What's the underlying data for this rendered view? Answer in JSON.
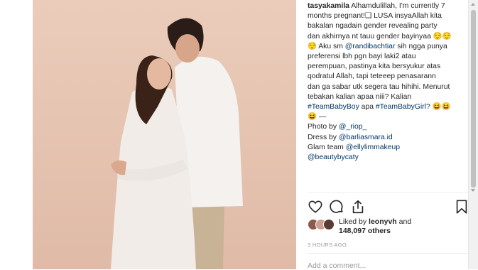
{
  "post": {
    "username": "tasyakamila",
    "caption_lines": [
      "Alhamdulillah, I'm currently 7",
      "months pregnant!❑ LUSA insyaAllah kita",
      "bakalan ngadain gender revealing party",
      "dan akhirnya nt tauu gender bayinyaa 😌😌",
      "😌 Aku sm ",
      " sih ngga punya",
      "preferensi lbh pgn bayi laki2 atau",
      "perempuan, pastinya kita bersyukur atas",
      "qodratul Allah, tapi teteeep penasarann",
      "dan ga sabar utk segera tau hihihi. Menurut",
      "tebakan kalian apaa niii? Kalian",
      " apa ",
      "😆 —"
    ],
    "mention_randi": "@randibachtiar",
    "hashtag_boy": "#TeamBabyBoy",
    "hashtag_girl": "#TeamBabyGirl",
    "emoji_after_girl": "? 😆😆",
    "photo_label": "Photo by ",
    "photo_handle": "@_riop_",
    "dress_label": "Dress by ",
    "dress_handle": "@barliasmara.id",
    "glam_label": "Glam team ",
    "glam_handle": "@ellylimmakeup",
    "beauty_handle": "@beautybycaty"
  },
  "actions": {
    "like_icon": "heart-icon",
    "comment_icon": "comment-icon",
    "share_icon": "share-icon",
    "save_icon": "bookmark-icon"
  },
  "likes": {
    "prefix": "Liked by ",
    "user": "leonyvh",
    "and": " and",
    "count": "148,097 others"
  },
  "timestamp": "3 HOURS AGO",
  "comment_placeholder": "Add a comment...",
  "colors": {
    "background_photo": "#e6c6b3",
    "link": "#003569",
    "muted": "#999999"
  }
}
